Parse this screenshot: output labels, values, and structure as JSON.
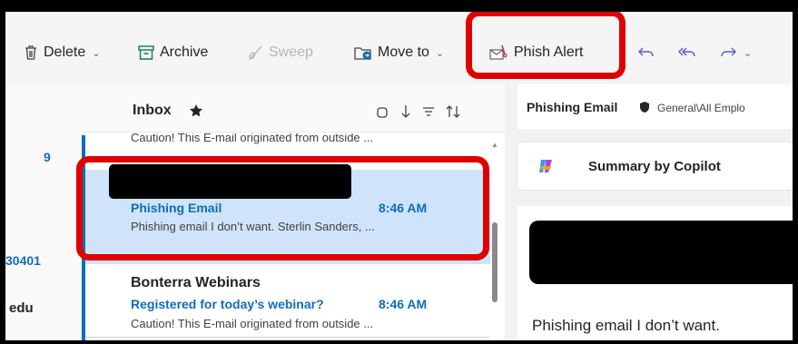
{
  "toolbar": {
    "delete_label": "Delete",
    "archive_label": "Archive",
    "sweep_label": "Sweep",
    "move_label": "Move to",
    "phish_label": "Phish Alert"
  },
  "leftnav": {
    "count": "9",
    "code": "30401",
    "domain": "edu"
  },
  "list": {
    "folder_title": "Inbox",
    "partial_preview": "Caution! This E-mail originated from outside ...",
    "messages": [
      {
        "sender": "",
        "subject": "Phishing Email",
        "time": "8:46 AM",
        "preview": "Phishing email I don’t want. Sterlin Sanders, ..."
      },
      {
        "sender": "Bonterra Webinars",
        "subject": "Registered for today’s webinar?",
        "time": "8:46 AM",
        "preview": "Caution! This E-mail originated from outside ..."
      }
    ]
  },
  "reading": {
    "subject": "Phishing Email",
    "category": "General\\All Emplo",
    "copilot_label": "Summary by Copilot",
    "body_text": "Phishing email I don’t want."
  },
  "colors": {
    "accent": "#0f6cbd",
    "selected_bg": "#cfe4fa",
    "highlight": "#e00000"
  }
}
